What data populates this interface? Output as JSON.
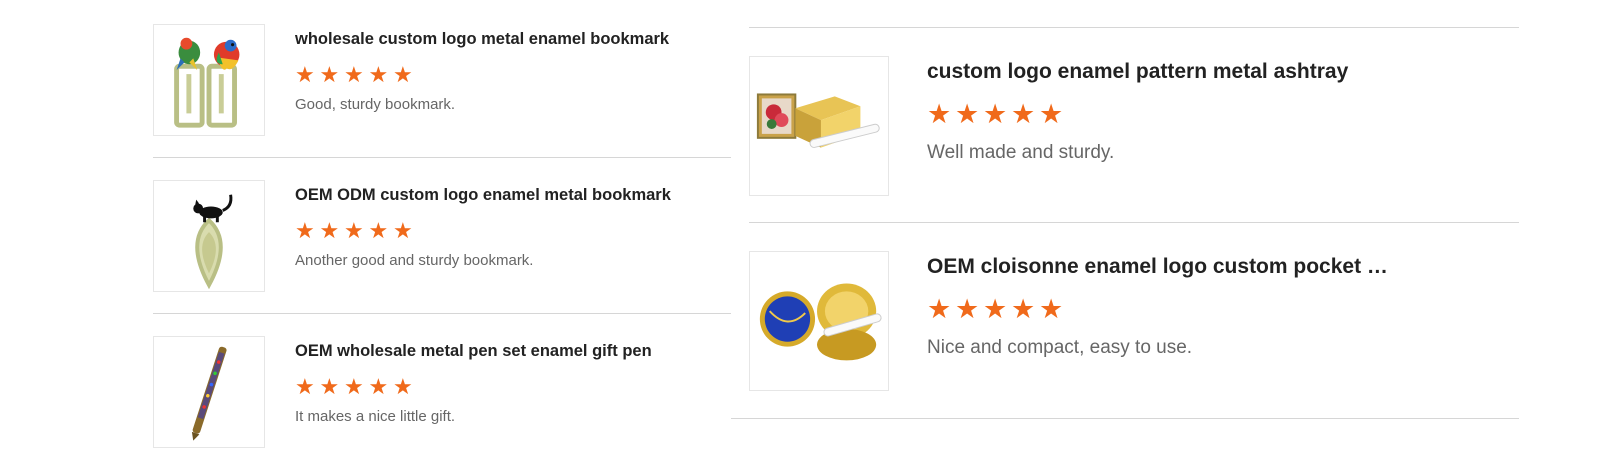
{
  "left_reviews": [
    {
      "title": "wholesale custom logo metal enamel bookmark",
      "rating": 5,
      "review": "Good, sturdy bookmark.",
      "image_icon": "parrot-bookmark-icon"
    },
    {
      "title": "OEM ODM custom logo enamel metal bookmark",
      "rating": 5,
      "review": "Another good and sturdy bookmark.",
      "image_icon": "cat-bookmark-icon"
    },
    {
      "title": "OEM wholesale metal pen set enamel gift pen",
      "rating": 5,
      "review": "It makes a nice little gift.",
      "image_icon": "enamel-pen-icon"
    }
  ],
  "right_reviews": [
    {
      "title": "custom logo enamel pattern metal ashtray",
      "rating": 5,
      "review": "Well made and sturdy.",
      "image_icon": "ashtray-icon"
    },
    {
      "title": "OEM cloisonne enamel logo custom pocket as...",
      "rating": 5,
      "review": "Nice and compact, easy to use.",
      "image_icon": "pocket-ashtray-icon"
    }
  ],
  "star_glyph": "★",
  "colors": {
    "star": "#f06a1b",
    "divider": "#d6d6d6",
    "review_text": "#666666",
    "title_text": "#222222"
  }
}
